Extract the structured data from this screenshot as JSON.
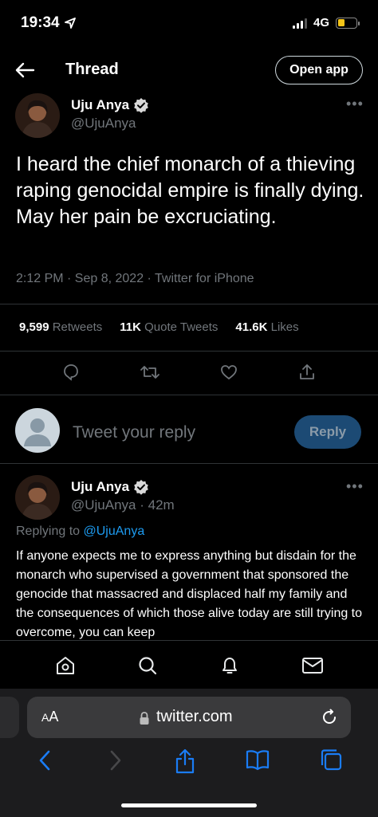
{
  "status_bar": {
    "time": "19:34",
    "network": "4G"
  },
  "header": {
    "title": "Thread",
    "open_app_label": "Open app"
  },
  "main_tweet": {
    "author_name": "Uju Anya",
    "handle": "@UjuAnya",
    "text": "I heard the chief monarch of a thieving raping genocidal empire is finally dying. May her pain be excruciating.",
    "meta": "2:12 PM · Sep 8, 2022 · Twitter for iPhone",
    "stats": {
      "retweets_count": "9,599",
      "retweets_label": "Retweets",
      "quotes_count": "11K",
      "quotes_label": "Quote Tweets",
      "likes_count": "41.6K",
      "likes_label": "Likes"
    }
  },
  "composer": {
    "placeholder": "Tweet your reply",
    "reply_label": "Reply"
  },
  "reply_tweet": {
    "author_name": "Uju Anya",
    "handle_time": "@UjuAnya · 42m",
    "replying_prefix": "Replying to",
    "replying_to": "@UjuAnya",
    "text": "If anyone expects me to express anything but disdain for the monarch who supervised a government that sponsored the genocide that massacred and displaced half my family and the consequences of which those alive today are still trying to overcome, you can keep"
  },
  "browser": {
    "aa_label_big": "A",
    "aa_label_small": "A",
    "url": "twitter.com"
  },
  "colors": {
    "accent": "#1d9bf0",
    "background": "#000000",
    "muted": "#71767b",
    "reply_button": "#1c4a74"
  }
}
